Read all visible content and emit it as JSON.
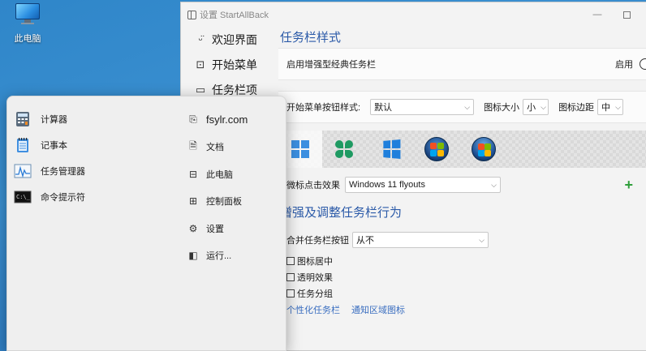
{
  "desktop": {
    "icons": [
      {
        "label": "此电脑",
        "icon": "computer-icon"
      }
    ]
  },
  "window": {
    "title": "设置 StartAllBack",
    "controls": {
      "minimize": "—",
      "maximize": "□"
    }
  },
  "nav": {
    "items": [
      {
        "label": "欢迎界面",
        "icon": "smile-icon"
      },
      {
        "label": "开始菜单",
        "icon": "start-menu-icon"
      },
      {
        "label": "任务栏项",
        "icon": "taskbar-icon"
      }
    ]
  },
  "taskbar_style": {
    "title": "任务栏样式",
    "enhanced_classic_label": "启用增强型经典任务栏",
    "enhanced_classic_state": "启用",
    "start_button_style_label": "开始菜单按钮样式:",
    "start_button_style_value": "默认",
    "icon_size_label": "图标大小",
    "icon_size_value": "小",
    "icon_margin_label": "图标边距",
    "icon_margin_value": "中",
    "start_orbs": [
      "win11-logo",
      "clover-logo",
      "win10-logo",
      "win7-orb",
      "vista-orb"
    ],
    "selected_orb": 0,
    "icon_click_label": "微标点击效果",
    "icon_click_value": "Windows 11 flyouts",
    "add_label": "+"
  },
  "enhance_behavior": {
    "title": "增强及调整任务栏行为",
    "combine_label": "合并任务栏按钮",
    "combine_value": "从不",
    "checkboxes": [
      {
        "label": "图标居中",
        "checked": false
      },
      {
        "label": "透明效果",
        "checked": false
      },
      {
        "label": "任务分组",
        "checked": false
      }
    ],
    "links": [
      "个性化任务栏",
      "通知区域图标"
    ]
  },
  "start_menu": {
    "apps": [
      {
        "label": "计算器",
        "icon": "calculator-icon"
      },
      {
        "label": "记事本",
        "icon": "notepad-icon"
      },
      {
        "label": "任务管理器",
        "icon": "task-manager-icon"
      },
      {
        "label": "命令提示符",
        "icon": "terminal-icon"
      }
    ],
    "places": [
      {
        "label": "fsylr.com",
        "icon": "user-folder-icon"
      },
      {
        "label": "文档",
        "icon": "document-icon"
      },
      {
        "label": "此电脑",
        "icon": "computer-icon"
      },
      {
        "label": "控制面板",
        "icon": "control-panel-icon"
      },
      {
        "label": "设置",
        "icon": "gear-icon"
      },
      {
        "label": "运行...",
        "icon": "run-icon"
      }
    ]
  },
  "colors": {
    "accent": "#2b5aa8",
    "link": "#3a6ec0",
    "add_green": "#2e9e3a",
    "desktop_blue": "#2f86c9"
  }
}
